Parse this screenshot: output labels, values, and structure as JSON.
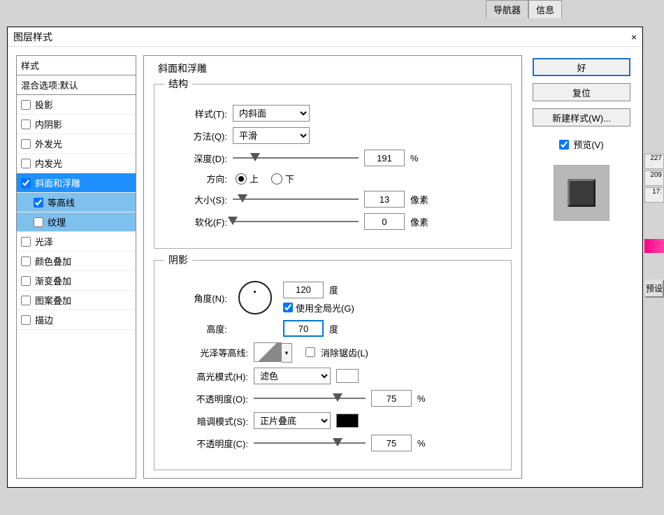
{
  "bg_tabs": {
    "nav": "导航器",
    "info": "信息"
  },
  "bg_right": {
    "n1": "227",
    "n2": "209",
    "n3": "17:",
    "preset": "预设"
  },
  "dialog": {
    "title": "图层样式",
    "styles_header": "样式",
    "blending_options": "混合选项:默认",
    "styles": {
      "drop_shadow": "投影",
      "inner_shadow": "内阴影",
      "outer_glow": "外发光",
      "inner_glow": "内发光",
      "bevel_emboss": "斜面和浮雕",
      "contour": "等高线",
      "texture": "纹理",
      "satin": "光泽",
      "color_overlay": "颜色叠加",
      "gradient_overlay": "渐变叠加",
      "pattern_overlay": "图案叠加",
      "stroke": "描边"
    },
    "right": {
      "ok": "好",
      "reset": "复位",
      "new_style": "新建样式(W)...",
      "preview": "预览(V)"
    },
    "settings": {
      "title": "斜面和浮雕",
      "structure": {
        "legend": "结构",
        "style_label": "样式(T):",
        "style_value": "内斜面",
        "technique_label": "方法(Q):",
        "technique_value": "平滑",
        "depth_label": "深度(D):",
        "depth_value": "191",
        "depth_unit": "%",
        "direction_label": "方向:",
        "dir_up": "上",
        "dir_down": "下",
        "size_label": "大小(S):",
        "size_value": "13",
        "size_unit": "像素",
        "soften_label": "软化(F):",
        "soften_value": "0",
        "soften_unit": "像素"
      },
      "shading": {
        "legend": "阴影",
        "angle_label": "角度(N):",
        "angle_value": "120",
        "angle_unit": "度",
        "global_light": "使用全局光(G)",
        "altitude_label": "高度:",
        "altitude_value": "70",
        "altitude_unit": "度",
        "gloss_contour_label": "光泽等高线:",
        "anti_alias": "消除锯齿(L)",
        "highlight_mode_label": "高光模式(H):",
        "highlight_mode_value": "滤色",
        "highlight_opacity_label": "不透明度(O):",
        "highlight_opacity_value": "75",
        "highlight_opacity_unit": "%",
        "shadow_mode_label": "暗调模式(S):",
        "shadow_mode_value": "正片叠底",
        "shadow_opacity_label": "不透明度(C):",
        "shadow_opacity_value": "75",
        "shadow_opacity_unit": "%"
      }
    }
  }
}
